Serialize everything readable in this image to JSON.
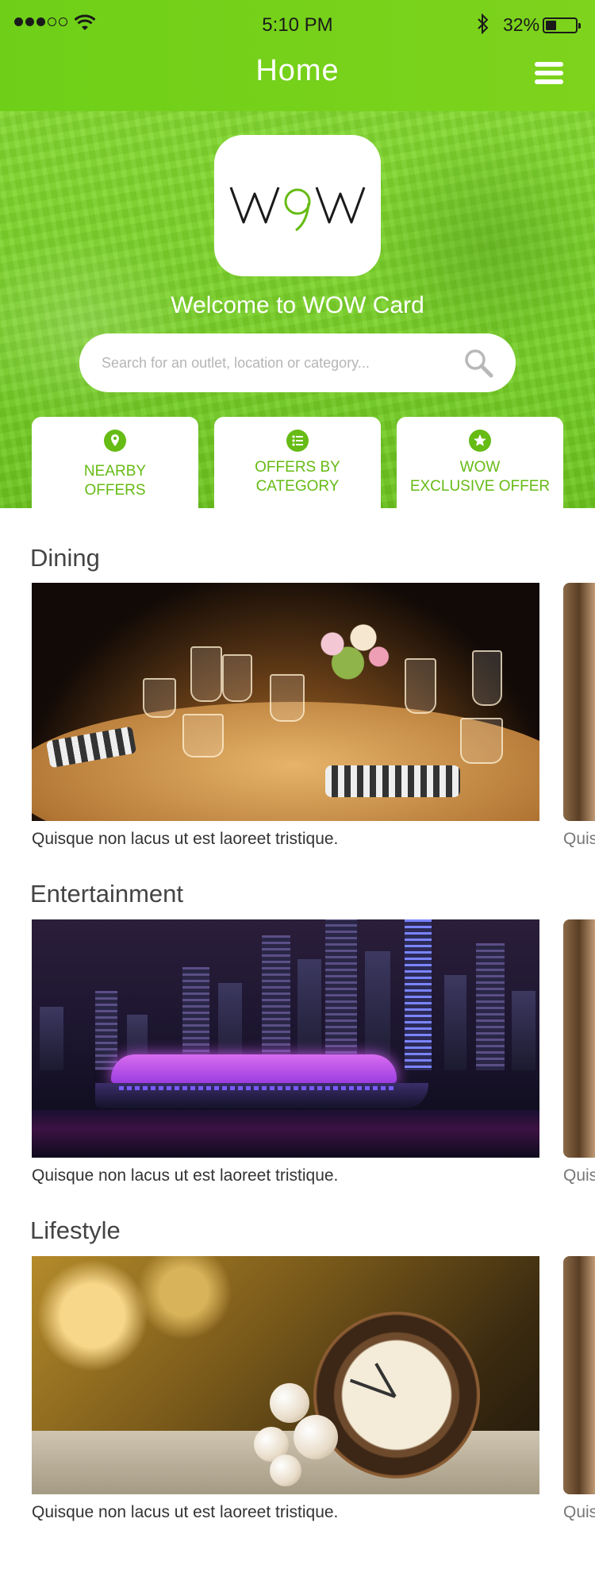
{
  "status_bar": {
    "time": "5:10 PM",
    "battery": "32%"
  },
  "nav": {
    "title": "Home",
    "menu_icon": "hamburger-menu-icon"
  },
  "hero": {
    "logo_text": "WOW",
    "welcome": "Welcome to WOW Card",
    "search_placeholder": "Search for an outlet, location or category...",
    "search_icon": "search-icon",
    "accent_color": "#66bb15"
  },
  "quick_actions": [
    {
      "icon": "location-pin-icon",
      "line1": "NEARBY",
      "line2": "OFFERS"
    },
    {
      "icon": "list-icon",
      "line1": "OFFERS BY",
      "line2": "CATEGORY"
    },
    {
      "icon": "star-icon",
      "line1": "WOW",
      "line2": "EXCLUSIVE OFFER"
    }
  ],
  "sections": [
    {
      "title": "Dining",
      "caption": "Quisque non lacus ut est laoreet tristique.",
      "peek_caption": "Quis"
    },
    {
      "title": "Entertainment",
      "caption": "Quisque non lacus ut est laoreet tristique.",
      "peek_caption": "Quis"
    },
    {
      "title": "Lifestyle",
      "caption": "Quisque non lacus ut est laoreet tristique.",
      "peek_caption": "Quis"
    }
  ]
}
